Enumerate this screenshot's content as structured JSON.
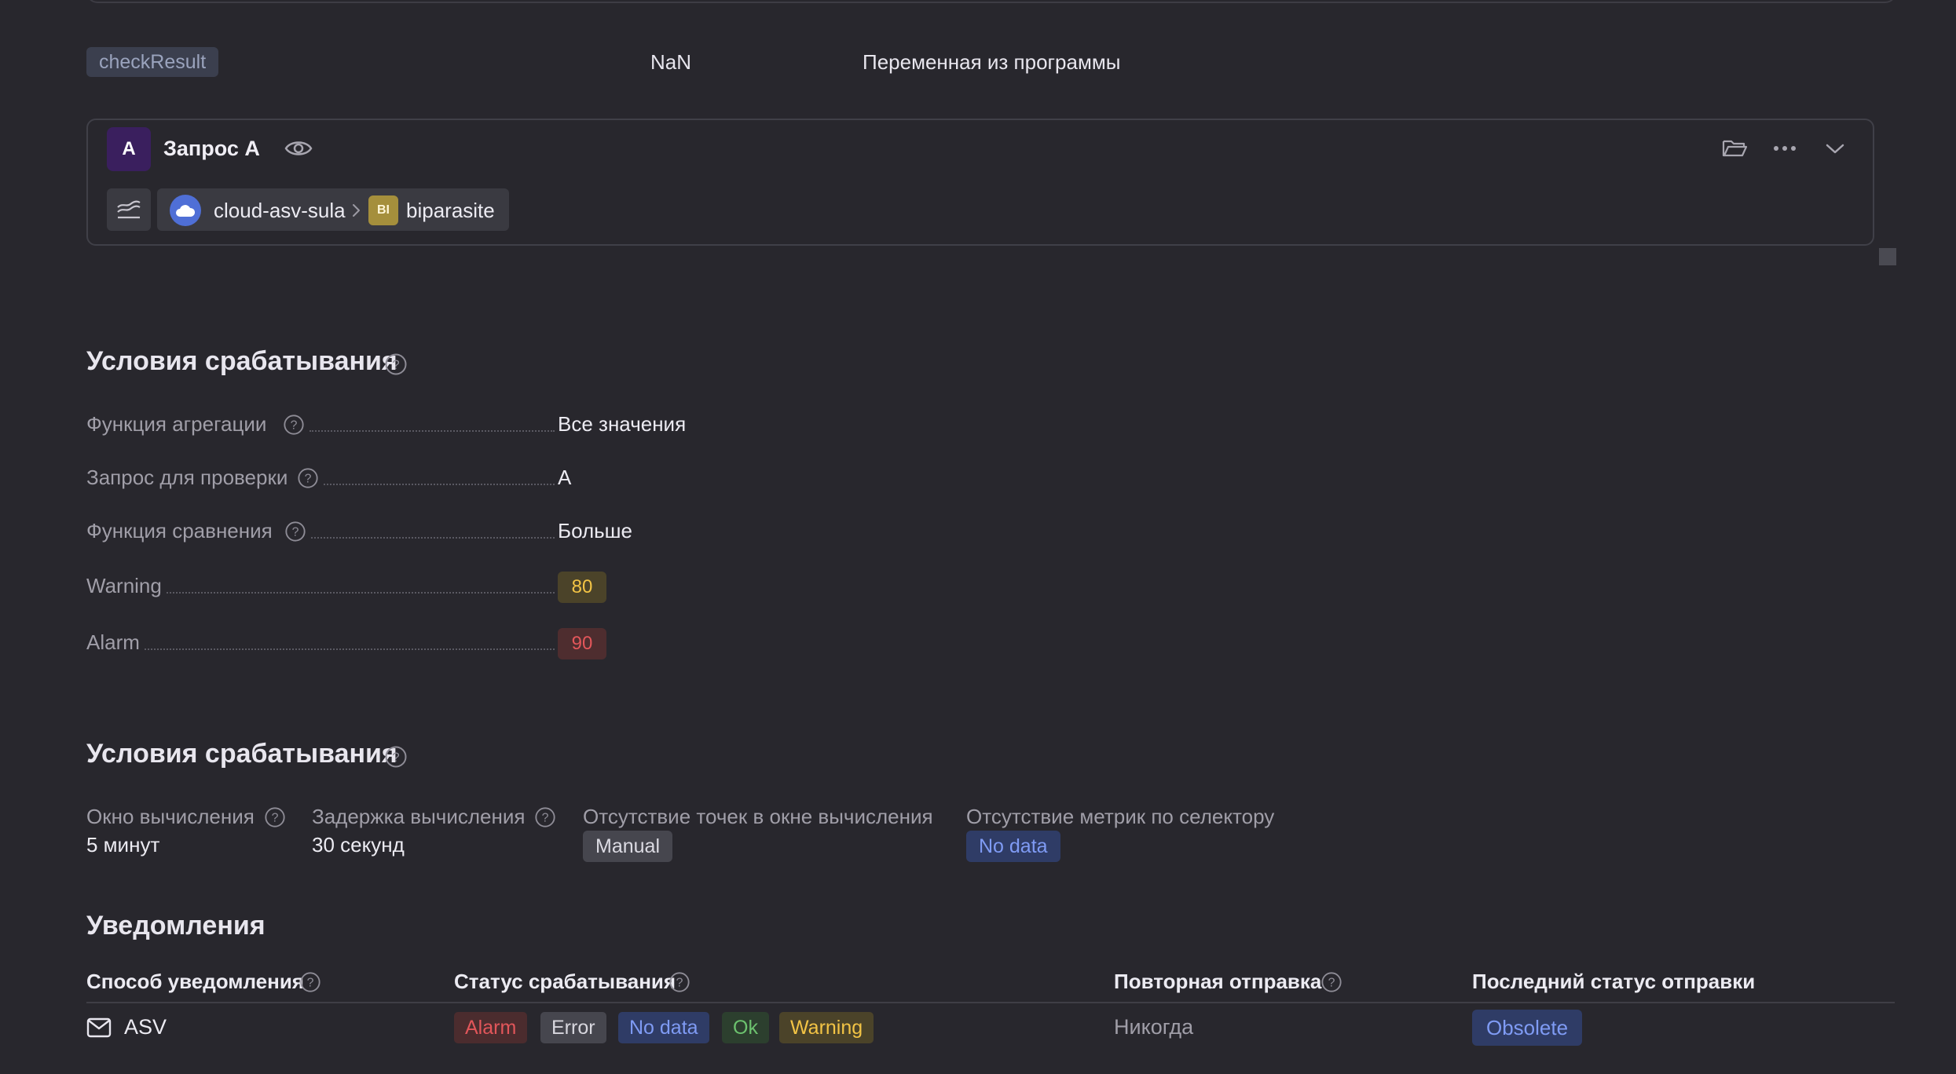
{
  "variable": {
    "name": "checkResult",
    "value": "NaN",
    "description": "Переменная из программы"
  },
  "query": {
    "letter": "A",
    "title": "Запрос A",
    "cloud": "cloud-asv-sula",
    "service_badge": "BI",
    "service": "biparasite",
    "icons": [
      "eye-icon",
      "folder-icon",
      "more-icon",
      "chevron-down-icon",
      "chart-type-icon",
      "cloud-icon",
      "chevron-right-icon"
    ]
  },
  "conditions": {
    "heading": "Условия срабатывания",
    "rows": [
      {
        "label": "Функция агрегации",
        "value": "Все значения"
      },
      {
        "label": "Запрос для проверки",
        "value": "A"
      },
      {
        "label": "Функция сравнения",
        "value": "Больше"
      },
      {
        "label": "Warning",
        "value": "80"
      },
      {
        "label": "Alarm",
        "value": "90"
      }
    ]
  },
  "settings": {
    "heading": "Условия срабатывания",
    "window_label": "Окно вычисления",
    "window_value": "5 минут",
    "delay_label": "Задержка вычисления",
    "delay_value": "30 секунд",
    "no_points_label": "Отсутствие точек в окне вычисления",
    "no_points_value": "Manual",
    "no_metrics_label": "Отсутствие метрик по селектору",
    "no_metrics_value": "No data"
  },
  "notifications": {
    "heading": "Уведомления",
    "columns": [
      "Способ уведомления",
      "Статус срабатывания",
      "Повторная отправка",
      "Последний статус отправки"
    ],
    "rows": [
      {
        "method": "ASV",
        "statuses": [
          "Alarm",
          "Error",
          "No data",
          "Ok",
          "Warning"
        ],
        "resend": "Никогда",
        "last_status": "Obsolete"
      }
    ]
  },
  "colors": {
    "background": "#28272d",
    "warning": "#f3c445",
    "alarm": "#e2565a",
    "ok": "#6cc26e",
    "nodata": "#7f9bf4"
  }
}
